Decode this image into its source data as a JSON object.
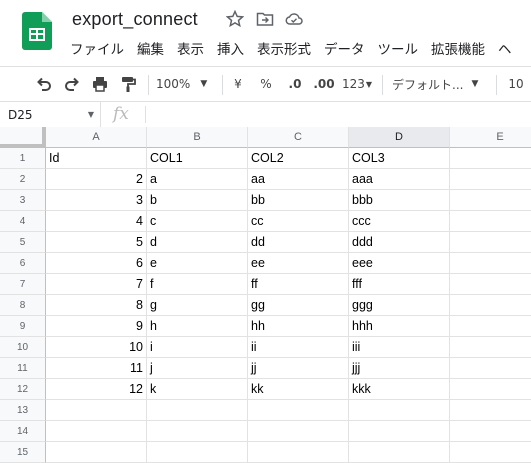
{
  "app": {
    "doc_title": "export_connect"
  },
  "menu": [
    "ファイル",
    "編集",
    "表示",
    "挿入",
    "表示形式",
    "データ",
    "ツール",
    "拡張機能",
    "ヘ"
  ],
  "toolbar": {
    "zoom": "100%",
    "currency": "¥",
    "percent": "%",
    "dec_decrease": ".0",
    "dec_increase": ".00",
    "number_format": "123",
    "font": "デフォルト...",
    "font_size": "10"
  },
  "formula_bar": {
    "cell_ref": "D25",
    "fx": "fx",
    "value": ""
  },
  "columns": [
    "A",
    "B",
    "C",
    "D",
    "E"
  ],
  "selected_column": "D",
  "rows": [
    {
      "n": "1",
      "cells": [
        "Id",
        "COL1",
        "COL2",
        "COL3",
        ""
      ]
    },
    {
      "n": "2",
      "cells": [
        "2",
        "a",
        "aa",
        "aaa",
        ""
      ]
    },
    {
      "n": "3",
      "cells": [
        "3",
        "b",
        "bb",
        "bbb",
        ""
      ]
    },
    {
      "n": "4",
      "cells": [
        "4",
        "c",
        "cc",
        "ccc",
        ""
      ]
    },
    {
      "n": "5",
      "cells": [
        "5",
        "d",
        "dd",
        "ddd",
        ""
      ]
    },
    {
      "n": "6",
      "cells": [
        "6",
        "e",
        "ee",
        "eee",
        ""
      ]
    },
    {
      "n": "7",
      "cells": [
        "7",
        "f",
        "ff",
        "fff",
        ""
      ]
    },
    {
      "n": "8",
      "cells": [
        "8",
        "g",
        "gg",
        "ggg",
        ""
      ]
    },
    {
      "n": "9",
      "cells": [
        "9",
        "h",
        "hh",
        "hhh",
        ""
      ]
    },
    {
      "n": "10",
      "cells": [
        "10",
        "i",
        "ii",
        "iii",
        ""
      ]
    },
    {
      "n": "11",
      "cells": [
        "11",
        "j",
        "jj",
        "jjj",
        ""
      ]
    },
    {
      "n": "12",
      "cells": [
        "12",
        "k",
        "kk",
        "kkk",
        ""
      ]
    },
    {
      "n": "13",
      "cells": [
        "",
        "",
        "",
        "",
        ""
      ]
    },
    {
      "n": "14",
      "cells": [
        "",
        "",
        "",
        "",
        ""
      ]
    },
    {
      "n": "15",
      "cells": [
        "",
        "",
        "",
        "",
        ""
      ]
    }
  ],
  "colors": {
    "brand": "#0f9d58",
    "header_bg": "#f8f9fa",
    "selected_header_bg": "#e8eaed"
  }
}
